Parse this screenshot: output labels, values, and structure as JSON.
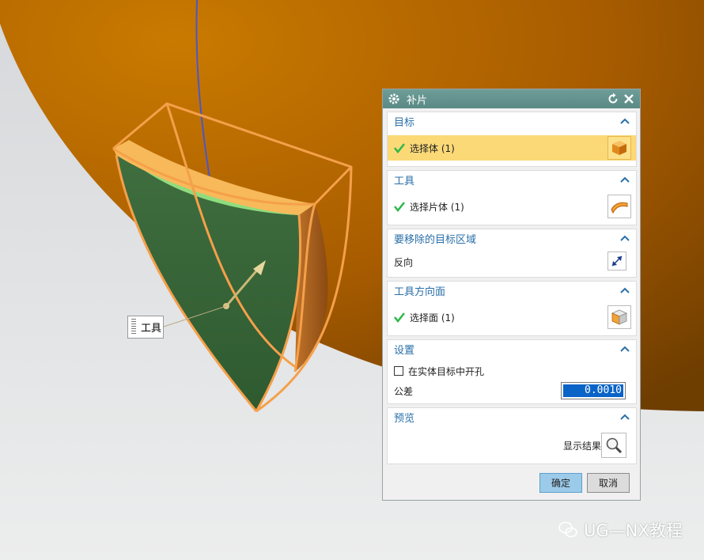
{
  "dialog": {
    "title": "补片",
    "sections": {
      "target": {
        "title": "目标",
        "row_label": "选择体 (1)"
      },
      "tool": {
        "title": "工具",
        "row_label": "选择片体 (1)"
      },
      "remove": {
        "title": "要移除的目标区域",
        "row_label": "反向"
      },
      "tool_face": {
        "title": "工具方向面",
        "row_label": "选择面 (1)"
      },
      "settings": {
        "title": "设置",
        "checkbox_label": "在实体目标中开孔",
        "checkbox_checked": false,
        "tolerance_label": "公差",
        "tolerance_value": "0.0010"
      },
      "preview": {
        "title": "预览",
        "show_result_label": "显示结果"
      }
    },
    "ok_label": "确定",
    "cancel_label": "取消"
  },
  "viewport": {
    "tool_tag_label": "工具"
  },
  "watermark": {
    "text": "UG—NX教程"
  },
  "colors": {
    "title_bar": "#5b8a86",
    "section_title": "#2a6fa8",
    "selected_row": "#fbd977",
    "check": "#2db84a",
    "solid_body": "#b86b00",
    "sheet_face": "#3e6b3e",
    "highlight": "#f5a04a"
  }
}
